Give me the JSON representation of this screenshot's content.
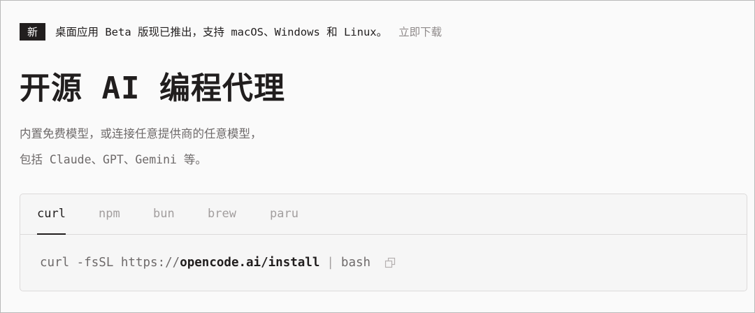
{
  "announcement": {
    "badge": "新",
    "text": "桌面应用 Beta 版现已推出，支持 macOS、Windows 和 Linux。",
    "link": "立即下载"
  },
  "hero": {
    "title": "开源 AI 编程代理",
    "subtitle_line1": "内置免费模型，或连接任意提供商的任意模型，",
    "subtitle_line2": "包括 Claude、GPT、Gemini 等。"
  },
  "install": {
    "tabs": [
      {
        "label": "curl",
        "active": true
      },
      {
        "label": "npm",
        "active": false
      },
      {
        "label": "bun",
        "active": false
      },
      {
        "label": "brew",
        "active": false
      },
      {
        "label": "paru",
        "active": false
      }
    ],
    "command_prefix": "curl -fsSL https://",
    "command_url": "opencode.ai/install",
    "command_pipe": "|",
    "command_suffix": "bash",
    "copy_icon": "copy-icon"
  },
  "colors": {
    "text": "#211e1e",
    "muted": "#6e6a6a",
    "faint": "#a29e9e",
    "background": "#fafafa",
    "border": "#dcdada"
  }
}
